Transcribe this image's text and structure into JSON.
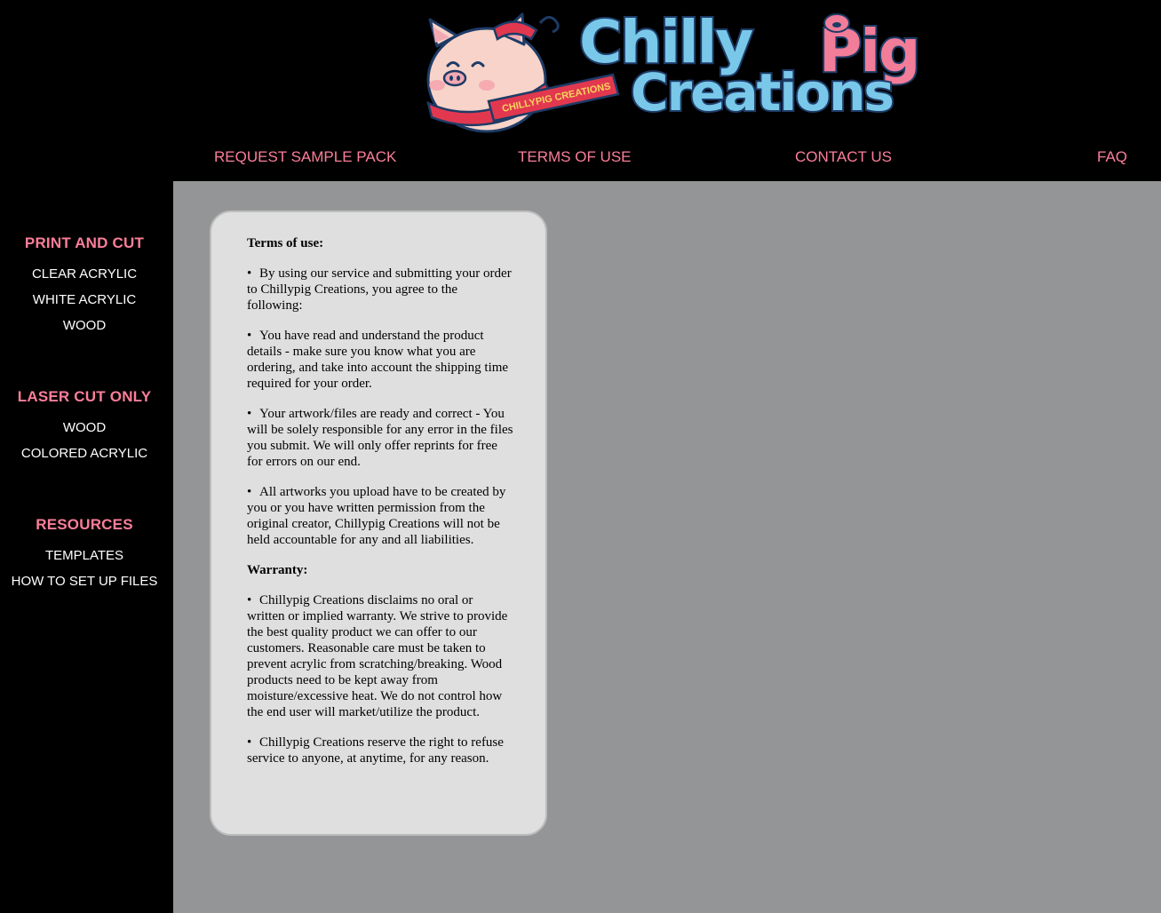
{
  "logo": {
    "line1a": "Chilly",
    "line1b": "Pig",
    "line2": "Creations",
    "banner": "CHILLYPIG CREATIONS",
    "colors": {
      "blue": "#79c8ea",
      "pink": "#f27d99",
      "outline": "#1e3b66",
      "pig": "#f7d3c9"
    }
  },
  "topnav": {
    "sample": "REQUEST SAMPLE PACK",
    "terms": "TERMS OF USE",
    "contact": "CONTACT US",
    "faq": "FAQ"
  },
  "sidebar": {
    "print_cut": {
      "heading": "PRINT AND CUT",
      "items": [
        "CLEAR ACRYLIC",
        "WHITE ACRYLIC",
        "WOOD"
      ]
    },
    "laser_cut": {
      "heading": "LASER CUT ONLY",
      "items": [
        "WOOD",
        "COLORED ACRYLIC"
      ]
    },
    "resources": {
      "heading": "RESOURCES",
      "items": [
        "TEMPLATES",
        "HOW TO SET UP FILES"
      ]
    }
  },
  "content": {
    "terms_heading": "Terms of use:",
    "bullet": "•",
    "terms": [
      "By using our service and submitting your order to Chillypig Creations, you agree to the following:",
      "You have read and understand the product details - make sure you know what you are ordering, and take into account the shipping time required for your order.",
      "Your artwork/files are ready and correct - You will be solely responsible for any error in the files you submit. We will only offer reprints for free for errors on our end.",
      "All artworks you upload have to be created by you or you have written permission from the original creator, Chillypig Creations will not be held accountable for any and all liabilities."
    ],
    "warranty_heading": "Warranty:",
    "warranty": [
      "Chillypig Creations disclaims no oral or written or implied warranty. We strive to provide the best quality product we can offer to our customers. Reasonable care must be taken to prevent acrylic from scratching/breaking. Wood products need to be kept away from moisture/excessive heat. We do not control how the end user will market/utilize the product.",
      "Chillypig Creations reserve the right to refuse service to anyone, at anytime, for any reason."
    ]
  },
  "colors": {
    "page_bg": "#000000",
    "accent_pink": "#fb7e99",
    "main_bg": "#949596",
    "card_bg": "#dfdfdf"
  }
}
